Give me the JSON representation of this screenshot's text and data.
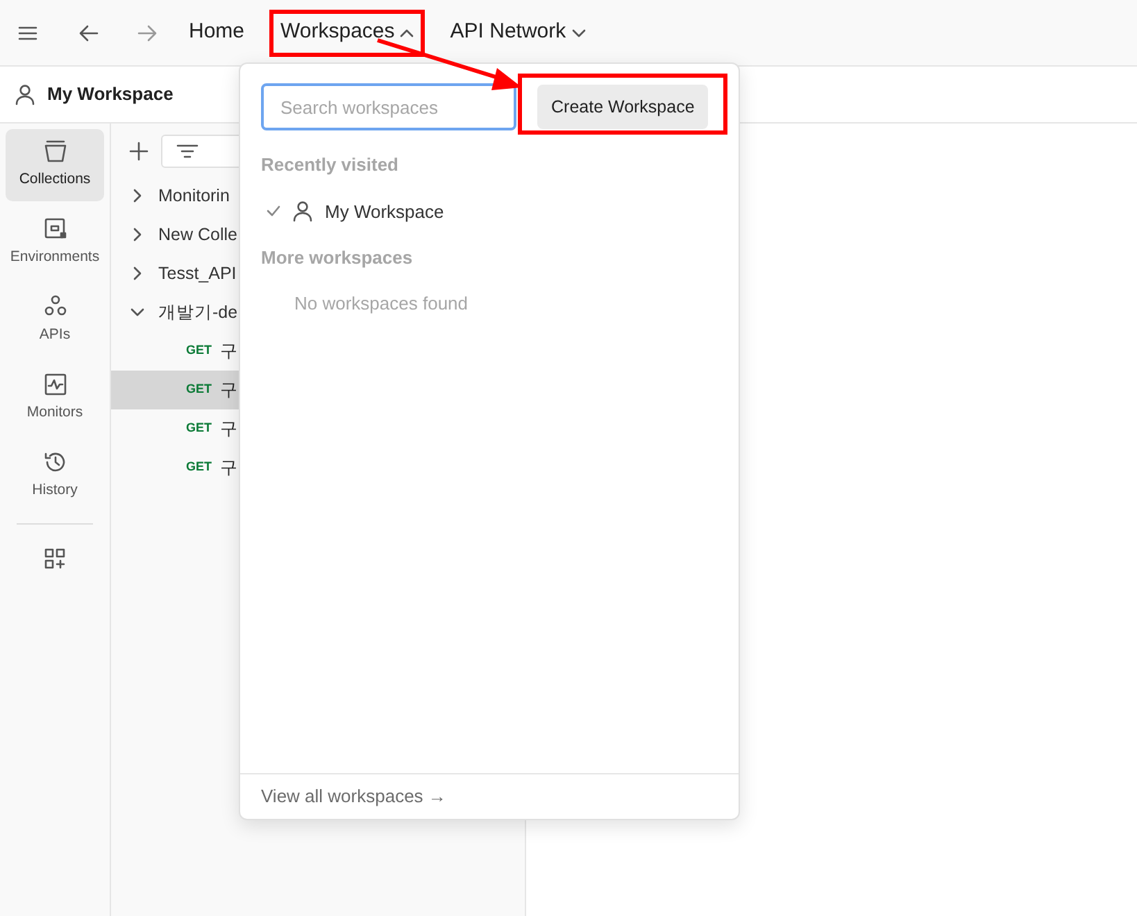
{
  "topbar": {
    "nav": [
      {
        "label": "Home",
        "kind": "link"
      },
      {
        "label": "Workspaces",
        "kind": "menu",
        "expanded": true
      },
      {
        "label": "API Network",
        "kind": "menu",
        "expanded": false
      }
    ]
  },
  "workspace_header": {
    "title": "My Workspace"
  },
  "rail": {
    "items": [
      {
        "label": "Collections",
        "selected": true
      },
      {
        "label": "Environments",
        "selected": false
      },
      {
        "label": "APIs",
        "selected": false
      },
      {
        "label": "Monitors",
        "selected": false
      },
      {
        "label": "History",
        "selected": false
      }
    ]
  },
  "collections": [
    {
      "label": "Monitorin",
      "expanded": false
    },
    {
      "label": "New Colle",
      "expanded": false
    },
    {
      "label": "Tesst_API",
      "expanded": false
    },
    {
      "label": "개발기-de",
      "expanded": true,
      "children": [
        {
          "method": "GET",
          "label": "구",
          "selected": false
        },
        {
          "method": "GET",
          "label": "구",
          "selected": true
        },
        {
          "method": "GET",
          "label": "구",
          "selected": false
        },
        {
          "method": "GET",
          "label": "구",
          "selected": false
        }
      ]
    }
  ],
  "dropdown": {
    "search": {
      "placeholder": "Search workspaces"
    },
    "create_button": "Create Workspace",
    "recently_visited": {
      "heading": "Recently visited",
      "items": [
        {
          "label": "My Workspace",
          "checked": true
        }
      ]
    },
    "more_workspaces": {
      "heading": "More workspaces",
      "empty_text": "No workspaces found"
    },
    "footer_link": "View all workspaces →"
  }
}
